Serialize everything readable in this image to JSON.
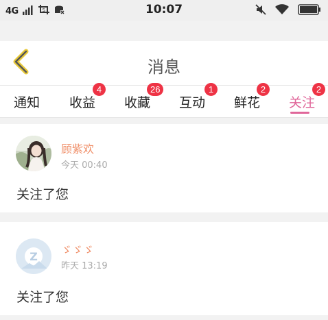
{
  "status_bar": {
    "network": "4G",
    "time": "10:07",
    "icons": [
      "signal-icon",
      "screenshot-icon",
      "sd-card-icon",
      "mute-icon",
      "wifi-icon",
      "battery-icon"
    ]
  },
  "header": {
    "title": "消息",
    "back_icon": "chevron-left-icon",
    "back_color": "#e8c93a"
  },
  "tabs": [
    {
      "label": "通知",
      "badge": ""
    },
    {
      "label": "收益",
      "badge": "4"
    },
    {
      "label": "收藏",
      "badge": "26"
    },
    {
      "label": "互动",
      "badge": "1"
    },
    {
      "label": "鲜花",
      "badge": "2"
    },
    {
      "label": "关注",
      "badge": "2",
      "active": true
    }
  ],
  "notifications": [
    {
      "name": "顾紫欢",
      "time": "今天 00:40",
      "message": "关注了您"
    },
    {
      "name": "ゞゞゞ",
      "time": "昨天 13:19",
      "message": "关注了您"
    }
  ],
  "colors": {
    "accent": "#e0679a",
    "badge": "#ee3345",
    "username": "#f0906a"
  }
}
